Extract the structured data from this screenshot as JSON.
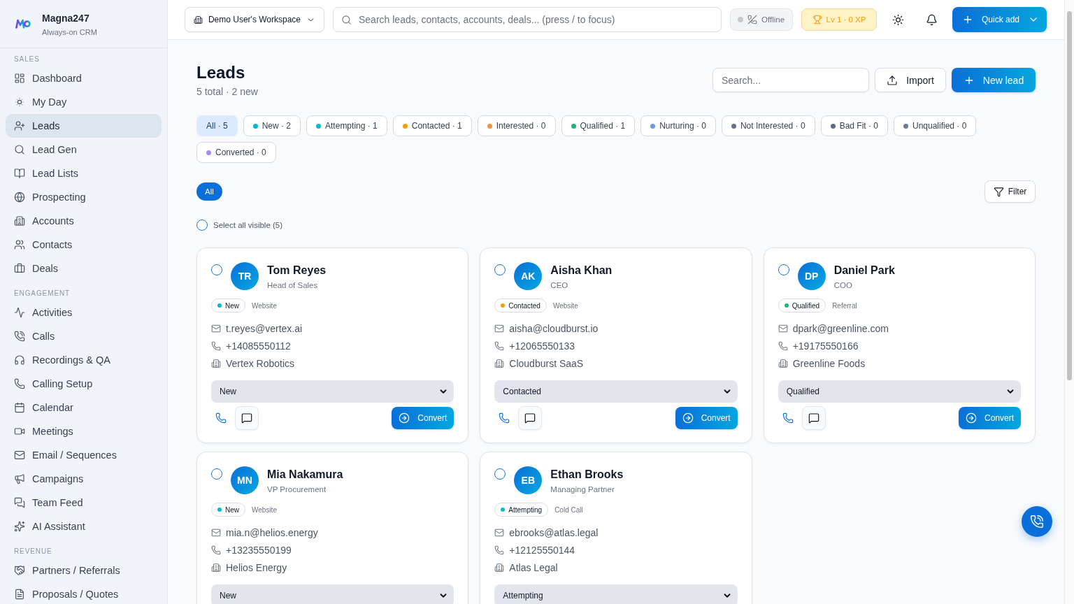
{
  "sidebar": {
    "brand": {
      "name": "Magna247",
      "tagline": "Always-on CRM"
    },
    "sections": [
      {
        "label": "SALES",
        "items": [
          {
            "label": "Dashboard",
            "selected": false
          },
          {
            "label": "My Day",
            "selected": false
          },
          {
            "label": "Leads",
            "selected": true
          },
          {
            "label": "Lead Gen",
            "selected": false
          },
          {
            "label": "Lead Lists",
            "selected": false
          },
          {
            "label": "Prospecting",
            "selected": false
          },
          {
            "label": "Accounts",
            "selected": false
          },
          {
            "label": "Contacts",
            "selected": false
          },
          {
            "label": "Deals",
            "selected": false
          }
        ]
      },
      {
        "label": "ENGAGEMENT",
        "items": [
          {
            "label": "Activities",
            "selected": false
          },
          {
            "label": "Calls",
            "selected": false
          },
          {
            "label": "Recordings & QA",
            "selected": false
          },
          {
            "label": "Calling Setup",
            "selected": false
          },
          {
            "label": "Calendar",
            "selected": false
          },
          {
            "label": "Meetings",
            "selected": false
          },
          {
            "label": "Email / Sequences",
            "selected": false
          },
          {
            "label": "Campaigns",
            "selected": false
          },
          {
            "label": "Team Feed",
            "selected": false
          },
          {
            "label": "AI Assistant",
            "selected": false
          }
        ]
      },
      {
        "label": "REVENUE",
        "items": [
          {
            "label": "Partners / Referrals",
            "selected": false
          },
          {
            "label": "Proposals / Quotes",
            "selected": false
          }
        ]
      }
    ]
  },
  "topbar": {
    "workspace": "Demo User's Workspace",
    "search": {
      "placeholder": "Search leads, contacts, accounts, deals... (press / to focus)"
    },
    "connection": "Offline",
    "level": "Lv 1 · 0 XP",
    "quick_add": "Quick add"
  },
  "page": {
    "title": "Leads",
    "summary": "5 total · 2 new",
    "search": {
      "placeholder": "Search..."
    },
    "import": "Import",
    "new_lead": "New lead"
  },
  "status_filters": [
    {
      "label": "All · 5",
      "selected": true
    },
    {
      "label": "New · 2",
      "selected": false,
      "color": "#06b6d4"
    },
    {
      "label": "Attempting · 1",
      "selected": false,
      "color": "#14b8c4"
    },
    {
      "label": "Contacted · 1",
      "selected": false,
      "color": "#f59e0b"
    },
    {
      "label": "Interested · 0",
      "selected": false,
      "color": "#f7923a"
    },
    {
      "label": "Qualified · 1",
      "selected": false,
      "color": "#22b573"
    },
    {
      "label": "Nurturing · 0",
      "selected": false,
      "color": "#6b9ed6"
    },
    {
      "label": "Not Interested · 0",
      "selected": false,
      "color": "#64748b"
    },
    {
      "label": "Bad Fit · 0",
      "selected": false,
      "color": "#5b6b82"
    },
    {
      "label": "Unqualified · 0",
      "selected": false,
      "color": "#6b7b8f"
    },
    {
      "label": "Converted · 0",
      "selected": false,
      "color": "#a78bfa"
    }
  ],
  "view_tabs": [
    {
      "label": "All",
      "selected": true
    }
  ],
  "filter": "Filter",
  "select_all": {
    "label": "Select all visible (5)",
    "checked": false
  },
  "leads": [
    {
      "initials": "TR",
      "name": "Tom Reyes",
      "title": "Head of Sales",
      "checked": false,
      "status": {
        "label": "New",
        "color": "#06b6d4"
      },
      "source": "Website",
      "email": "t.reyes@vertex.ai",
      "phone": "+14085550112",
      "company": "Vertex Robotics",
      "stage": "New",
      "convert": "Convert"
    },
    {
      "initials": "AK",
      "name": "Aisha Khan",
      "title": "CEO",
      "checked": false,
      "status": {
        "label": "Contacted",
        "color": "#f59e0b"
      },
      "source": "Website",
      "email": "aisha@cloudburst.io",
      "phone": "+12065550133",
      "company": "Cloudburst SaaS",
      "stage": "Contacted",
      "convert": "Convert"
    },
    {
      "initials": "DP",
      "name": "Daniel Park",
      "title": "COO",
      "checked": false,
      "status": {
        "label": "Qualified",
        "color": "#22b573"
      },
      "source": "Referral",
      "email": "dpark@greenline.com",
      "phone": "+19175550166",
      "company": "Greenline Foods",
      "stage": "Qualified",
      "convert": "Convert"
    },
    {
      "initials": "MN",
      "name": "Mia Nakamura",
      "title": "VP Procurement",
      "checked": false,
      "status": {
        "label": "New",
        "color": "#06b6d4"
      },
      "source": "Website",
      "email": "mia.n@helios.energy",
      "phone": "+13235550199",
      "company": "Helios Energy",
      "stage": "New"
    },
    {
      "initials": "EB",
      "name": "Ethan Brooks",
      "title": "Managing Partner",
      "checked": false,
      "status": {
        "label": "Attempting",
        "color": "#14b8c4"
      },
      "source": "Cold Call",
      "email": "ebrooks@atlas.legal",
      "phone": "+12125550144",
      "company": "Atlas Legal",
      "stage": "Attempting"
    }
  ]
}
